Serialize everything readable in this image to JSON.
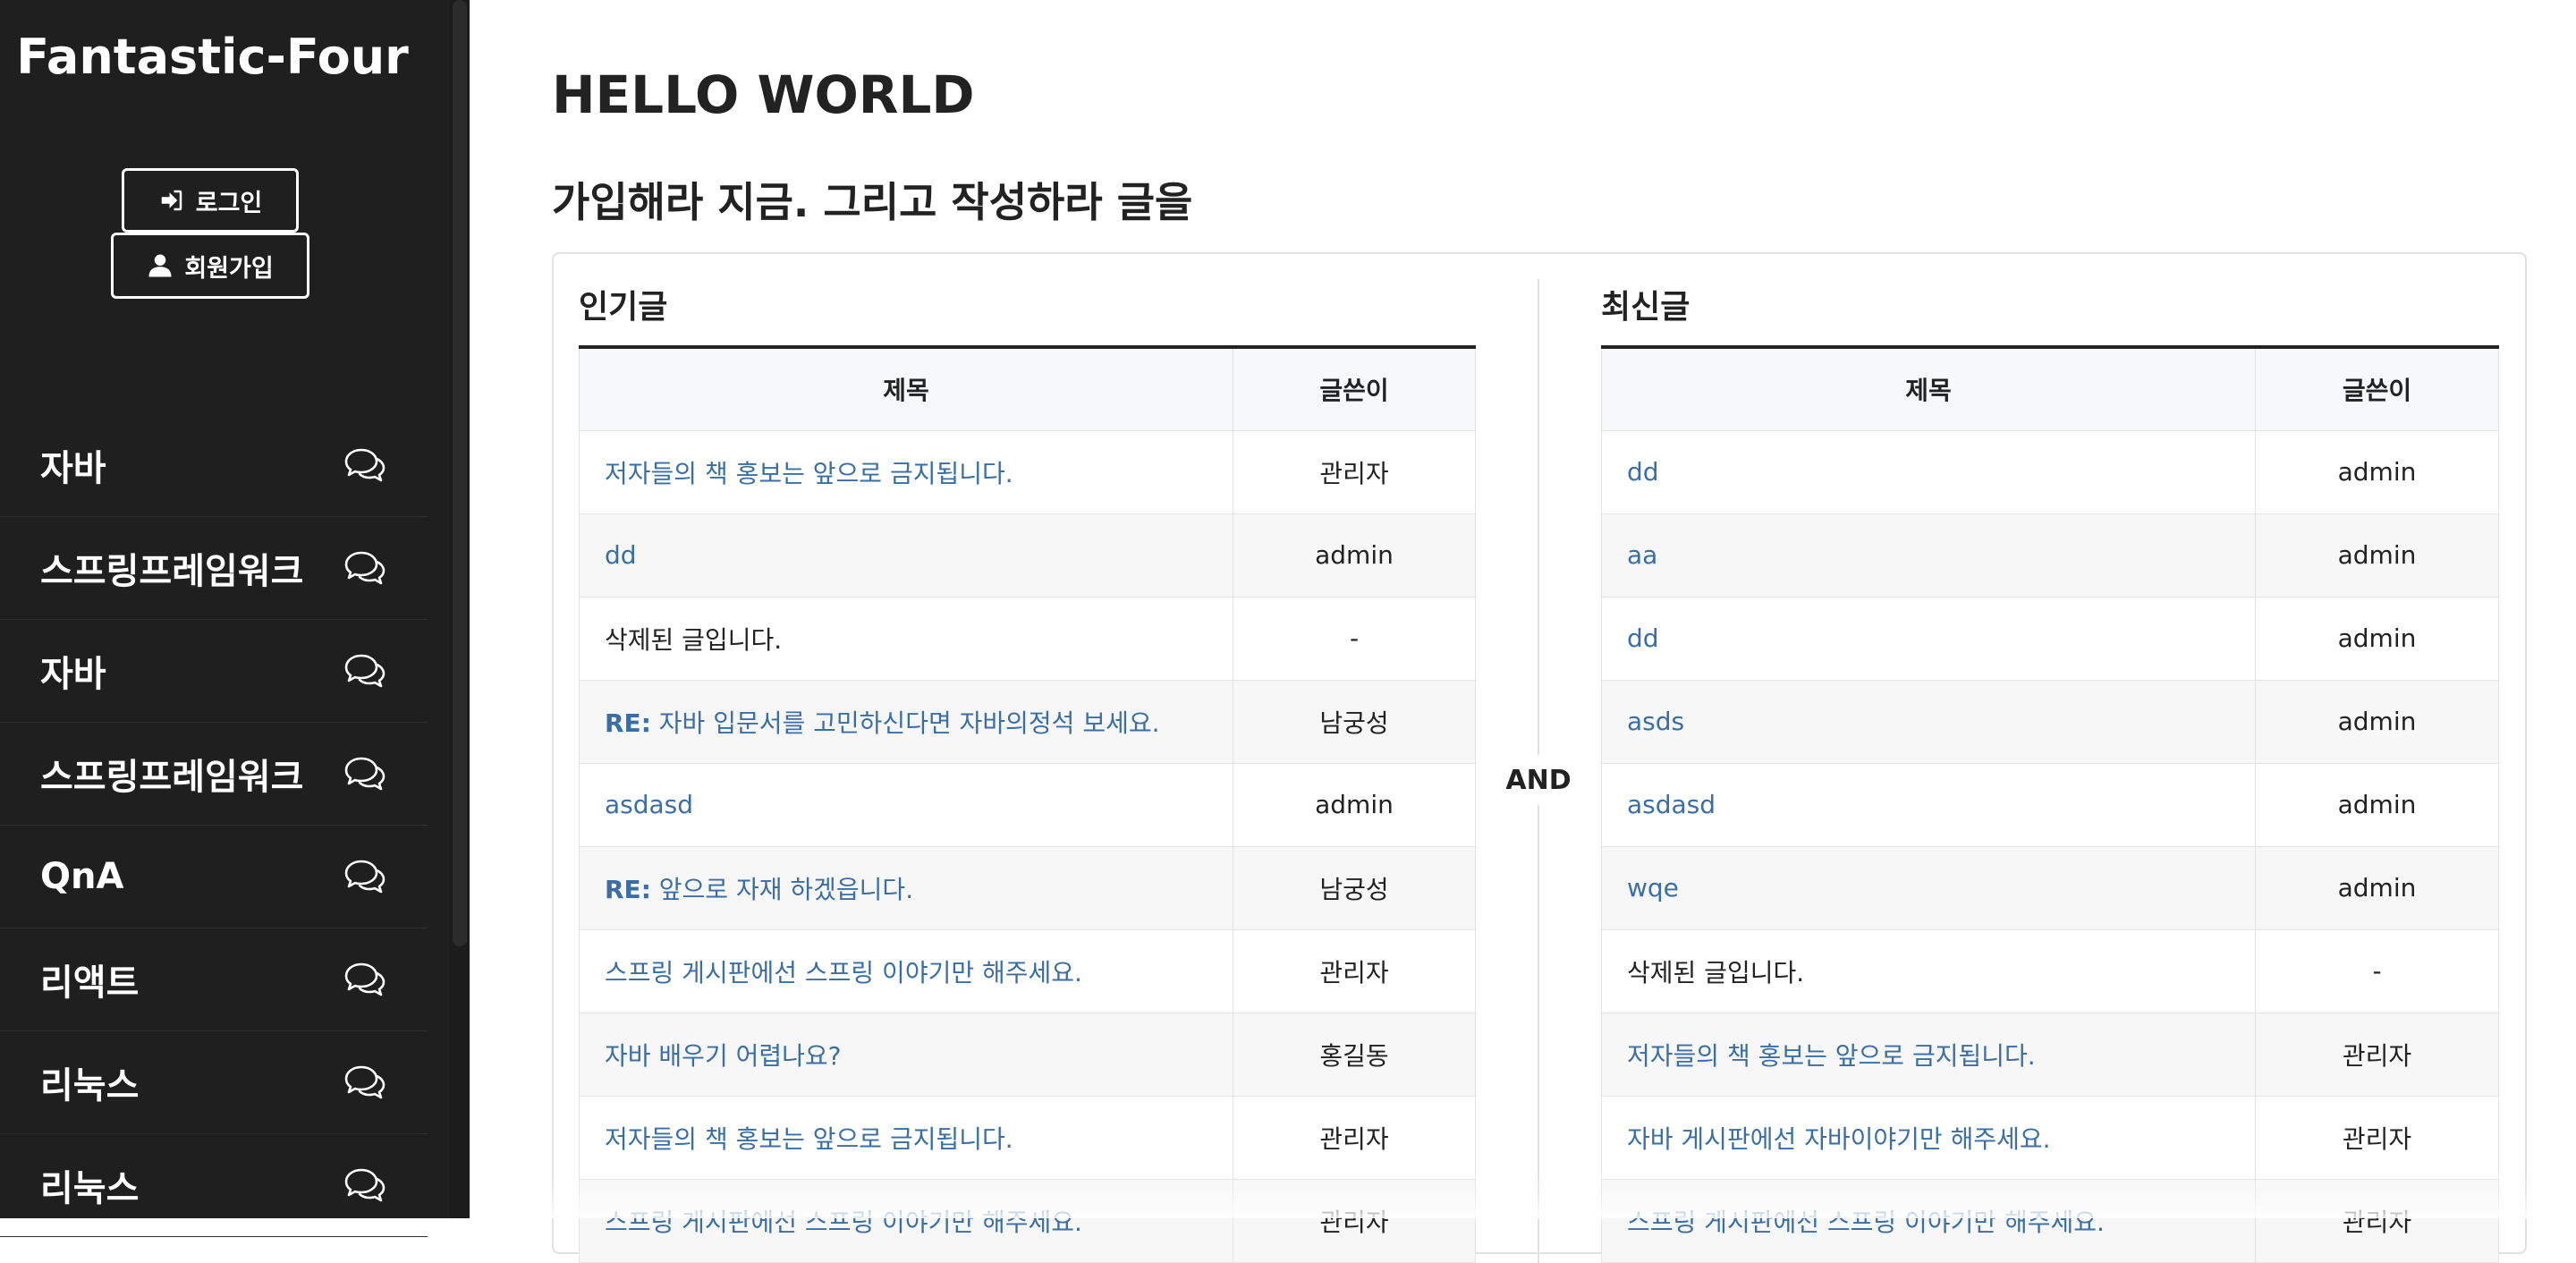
{
  "sidebar": {
    "brand": "Fantastic-Four",
    "login_label": "로그인",
    "signup_label": "회원가입",
    "items": [
      {
        "label": "자바",
        "icon": "comments-icon"
      },
      {
        "label": "스프링프레임워크",
        "icon": "comments-icon"
      },
      {
        "label": "자바",
        "icon": "comments-icon"
      },
      {
        "label": "스프링프레임워크",
        "icon": "comments-icon"
      },
      {
        "label": "QnA",
        "icon": "comments-icon"
      },
      {
        "label": "리액트",
        "icon": "comments-icon"
      },
      {
        "label": "리눅스",
        "icon": "comments-icon"
      },
      {
        "label": "리눅스",
        "icon": "comments-icon"
      }
    ]
  },
  "main": {
    "title": "HELLO WORLD",
    "subtitle": "가입해라 지금. 그리고 작성하라 글을",
    "separator": "AND",
    "popular": {
      "title": "인기글",
      "headers": {
        "title": "제목",
        "author": "글쓴이"
      },
      "rows": [
        {
          "prefix": "",
          "title": "저자들의 책 홍보는 앞으로 금지됩니다.",
          "author": "관리자",
          "deleted": false
        },
        {
          "prefix": "",
          "title": "dd",
          "author": "admin",
          "deleted": false
        },
        {
          "prefix": "",
          "title": "삭제된 글입니다.",
          "author": "-",
          "deleted": true
        },
        {
          "prefix": "RE:",
          "title": " 자바 입문서를 고민하신다면 자바의정석 보세요.",
          "author": "남궁성",
          "deleted": false
        },
        {
          "prefix": "",
          "title": "asdasd",
          "author": "admin",
          "deleted": false
        },
        {
          "prefix": "RE:",
          "title": " 앞으로 자재 하겠읍니다.",
          "author": "남궁성",
          "deleted": false
        },
        {
          "prefix": "",
          "title": "스프링 게시판에선 스프링 이야기만 해주세요.",
          "author": "관리자",
          "deleted": false
        },
        {
          "prefix": "",
          "title": "자바 배우기 어렵나요?",
          "author": "홍길동",
          "deleted": false
        },
        {
          "prefix": "",
          "title": "저자들의 책 홍보는 앞으로 금지됩니다.",
          "author": "관리자",
          "deleted": false
        },
        {
          "prefix": "",
          "title": "스프링 게시판에선 스프링 이야기만 해주세요.",
          "author": "관리자",
          "deleted": false
        }
      ]
    },
    "recent": {
      "title": "최신글",
      "headers": {
        "title": "제목",
        "author": "글쓴이"
      },
      "rows": [
        {
          "prefix": "",
          "title": "dd",
          "author": "admin",
          "deleted": false
        },
        {
          "prefix": "",
          "title": "aa",
          "author": "admin",
          "deleted": false
        },
        {
          "prefix": "",
          "title": "dd",
          "author": "admin",
          "deleted": false
        },
        {
          "prefix": "",
          "title": "asds",
          "author": "admin",
          "deleted": false
        },
        {
          "prefix": "",
          "title": "asdasd",
          "author": "admin",
          "deleted": false
        },
        {
          "prefix": "",
          "title": "wqe",
          "author": "admin",
          "deleted": false
        },
        {
          "prefix": "",
          "title": "삭제된 글입니다.",
          "author": "-",
          "deleted": true
        },
        {
          "prefix": "",
          "title": "저자들의 책 홍보는 앞으로 금지됩니다.",
          "author": "관리자",
          "deleted": false
        },
        {
          "prefix": "",
          "title": "자바 게시판에선 자바이야기만 해주세요.",
          "author": "관리자",
          "deleted": false
        },
        {
          "prefix": "",
          "title": "스프링 게시판에선 스프링 이야기만 해주세요.",
          "author": "관리자",
          "deleted": false
        }
      ]
    }
  },
  "colors": {
    "sidebar_bg": "#1f1f1f",
    "link": "#3a6ea5",
    "text": "#222222",
    "row_alt": "#f7f7f7"
  }
}
